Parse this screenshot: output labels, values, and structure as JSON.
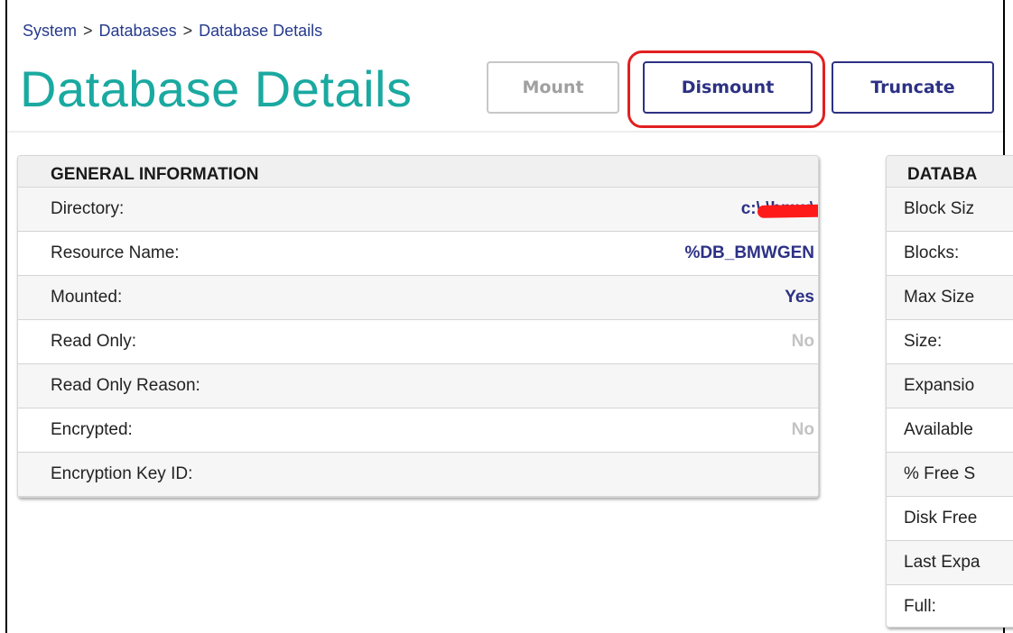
{
  "breadcrumb": {
    "items": [
      "System",
      "Databases",
      "Database Details"
    ],
    "separator": ">"
  },
  "page_title": "Database Details",
  "toolbar": {
    "mount_label": "Mount",
    "dismount_label": "Dismount",
    "truncate_label": "Truncate"
  },
  "colors": {
    "title": "#1aa9a0",
    "primary": "#2c3184",
    "highlight": "#e22020",
    "disabled": "#a0a0a0"
  },
  "general": {
    "header": "GENERAL INFORMATION",
    "rows": [
      {
        "label": "Directory:",
        "value": "c:\\                              \\bmw\\"
      },
      {
        "label": "Resource Name:",
        "value": "%DB_BMWGEN"
      },
      {
        "label": "Mounted:",
        "value": "Yes"
      },
      {
        "label": "Read Only:",
        "value": "No"
      },
      {
        "label": "Read Only Reason:",
        "value": ""
      },
      {
        "label": "Encrypted:",
        "value": "No"
      },
      {
        "label": "Encryption Key ID:",
        "value": ""
      }
    ]
  },
  "database": {
    "header": "DATABA",
    "rows": [
      {
        "label": "Block Siz"
      },
      {
        "label": "Blocks:"
      },
      {
        "label": "Max Size"
      },
      {
        "label": "Size:"
      },
      {
        "label": "Expansio"
      },
      {
        "label": "Available"
      },
      {
        "label": "% Free S"
      },
      {
        "label": "Disk Free"
      },
      {
        "label": "Last Expa"
      },
      {
        "label": "Full:"
      }
    ]
  }
}
